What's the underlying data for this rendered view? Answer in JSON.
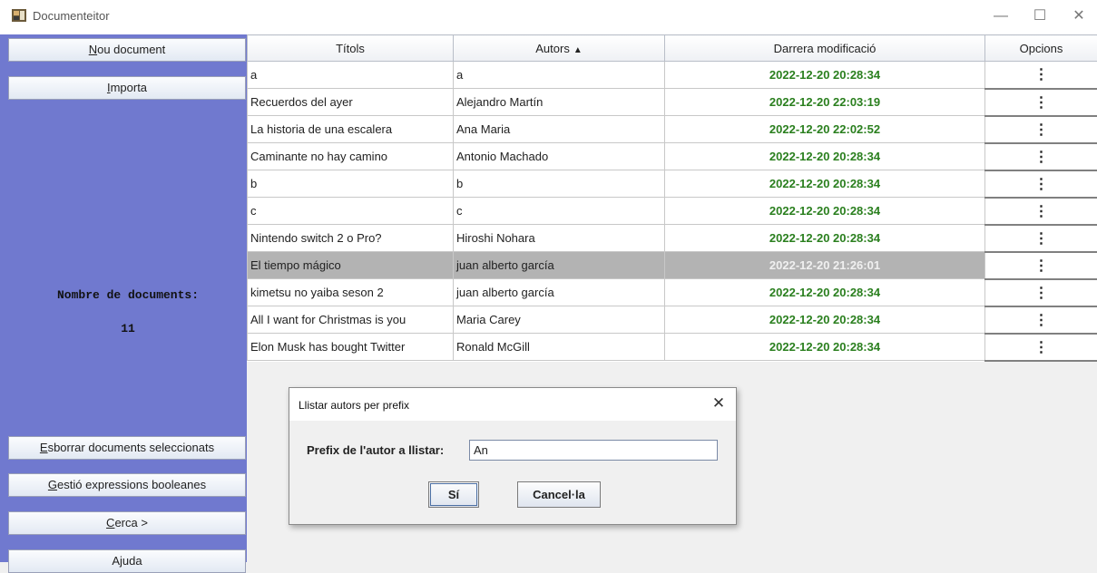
{
  "window": {
    "title": "Documenteitor",
    "minimize": "—",
    "maximize": "☐",
    "close": "✕"
  },
  "sidebar": {
    "buttons": {
      "new_doc": {
        "mnemonic": "N",
        "rest": "ou document"
      },
      "import": {
        "mnemonic": "I",
        "rest": "mporta"
      },
      "delete_selected": {
        "mnemonic": "E",
        "rest": "sborrar documents seleccionats"
      },
      "boolean_expr": {
        "mnemonic": "G",
        "rest": "estió expressions booleanes"
      },
      "search": {
        "mnemonic": "C",
        "rest": "erca >"
      },
      "help": {
        "mnemonic": "",
        "rest": "Ajuda"
      }
    },
    "count_label": "Nombre de documents:",
    "count_value": "11"
  },
  "table": {
    "headers": {
      "title": "Títols",
      "author": "Autors",
      "modified": "Darrera modificació",
      "options": "Opcions"
    },
    "sort_indicator": "▲",
    "option_glyph": "⋮",
    "rows": [
      {
        "title": "a",
        "author": "a",
        "modified": "2022-12-20 20:28:34"
      },
      {
        "title": "Recuerdos del ayer",
        "author": "Alejandro Martín",
        "modified": "2022-12-20 22:03:19"
      },
      {
        "title": "La historia de una escalera",
        "author": "Ana Maria",
        "modified": "2022-12-20 22:02:52"
      },
      {
        "title": "Caminante no hay camino",
        "author": "Antonio Machado",
        "modified": "2022-12-20 20:28:34"
      },
      {
        "title": "b",
        "author": "b",
        "modified": "2022-12-20 20:28:34"
      },
      {
        "title": "c",
        "author": "c",
        "modified": "2022-12-20 20:28:34"
      },
      {
        "title": "Nintendo switch 2 o Pro?",
        "author": "Hiroshi Nohara",
        "modified": "2022-12-20 20:28:34"
      },
      {
        "title": "El tiempo mágico",
        "author": "juan alberto garcía",
        "modified": "2022-12-20 21:26:01"
      },
      {
        "title": "kimetsu no yaiba seson 2",
        "author": "juan alberto garcía",
        "modified": "2022-12-20 20:28:34"
      },
      {
        "title": "All I want for Christmas is you",
        "author": "Maria Carey",
        "modified": "2022-12-20 20:28:34"
      },
      {
        "title": "Elon Musk has bought Twitter",
        "author": "Ronald McGill",
        "modified": "2022-12-20 20:28:34"
      }
    ]
  },
  "dialog": {
    "title": "Llistar autors per prefix",
    "close": "✕",
    "label": "Prefix de l'autor a llistar:",
    "input_value": "An",
    "ok_label": "Sí",
    "cancel_label": "Cancel·la"
  }
}
